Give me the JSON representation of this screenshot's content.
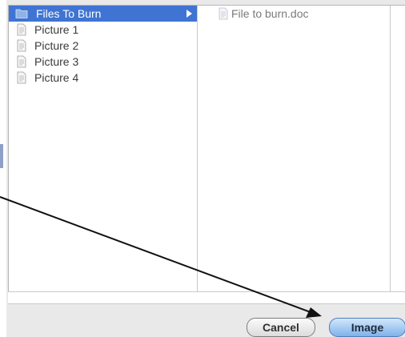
{
  "browser": {
    "column1": {
      "selected": {
        "label": "Files To Burn",
        "icon": "folder-icon"
      },
      "items": [
        {
          "label": "Picture 1",
          "icon": "document-icon"
        },
        {
          "label": "Picture 2",
          "icon": "document-icon"
        },
        {
          "label": "Picture 3",
          "icon": "document-icon"
        },
        {
          "label": "Picture 4",
          "icon": "document-icon"
        }
      ]
    },
    "column2": {
      "items": [
        {
          "label": "File to burn.doc",
          "icon": "document-icon"
        }
      ]
    },
    "resize_handle_glyph": "II"
  },
  "buttons": {
    "cancel_label": "Cancel",
    "image_label": "Image"
  },
  "colors": {
    "selection": "#3f74d3",
    "default_button": "#7fb2ea"
  }
}
